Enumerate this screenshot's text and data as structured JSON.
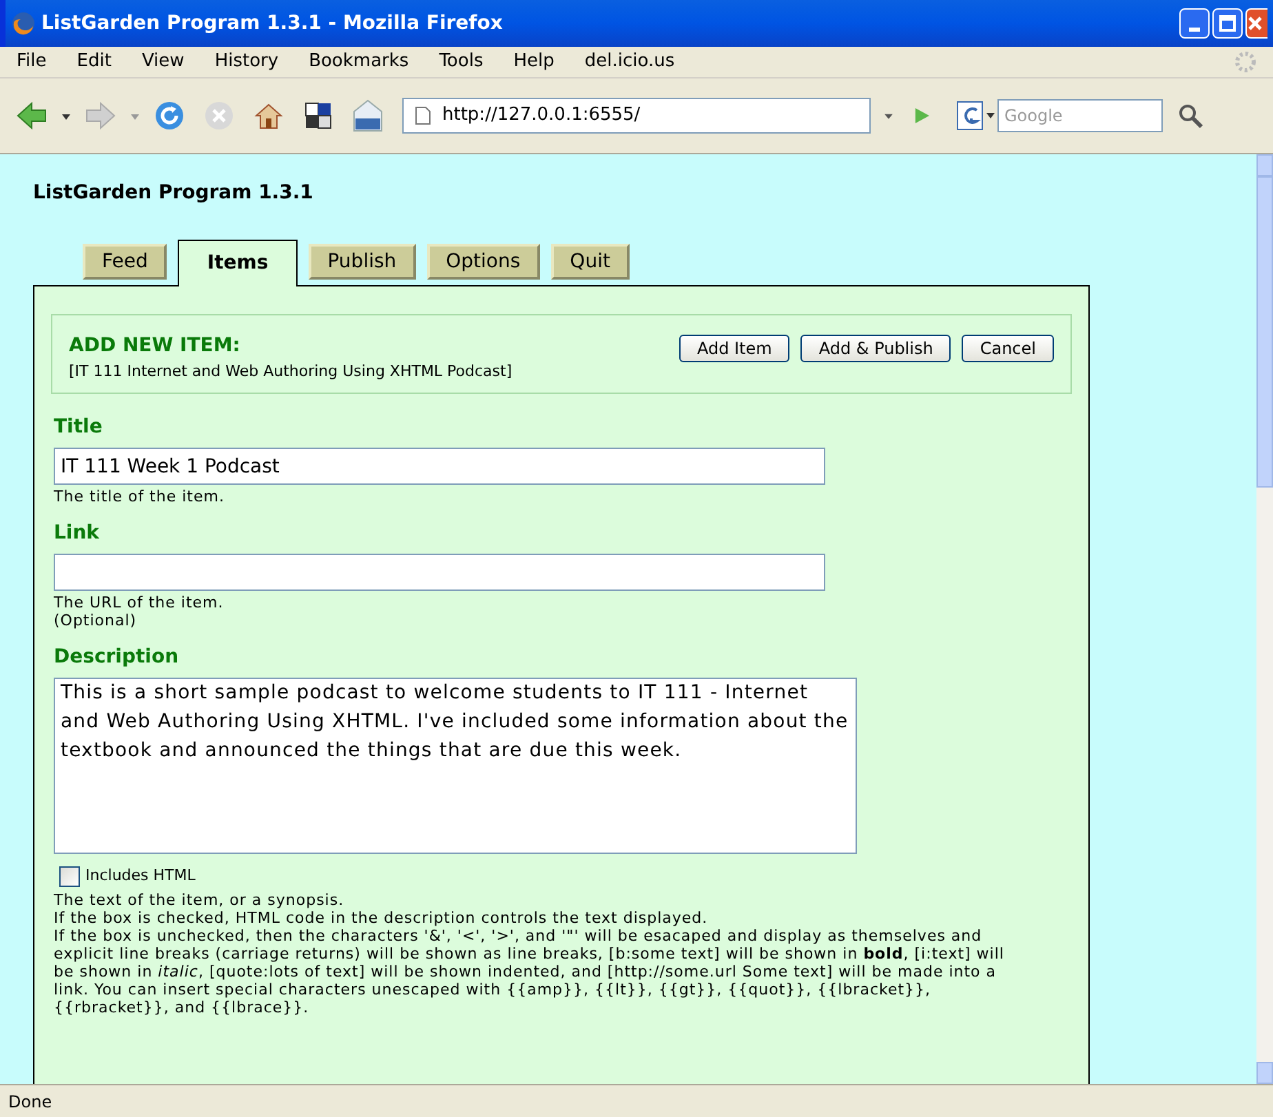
{
  "window": {
    "title": "ListGarden Program 1.3.1 - Mozilla Firefox"
  },
  "menu": [
    "File",
    "Edit",
    "View",
    "History",
    "Bookmarks",
    "Tools",
    "Help",
    "del.icio.us"
  ],
  "address_bar": {
    "value": "http://127.0.0.1:6555/"
  },
  "search": {
    "placeholder": "Google"
  },
  "page": {
    "heading": "ListGarden Program 1.3.1",
    "tabs": [
      {
        "label": "Feed",
        "selected": false
      },
      {
        "label": "Items",
        "selected": true
      },
      {
        "label": "Publish",
        "selected": false
      },
      {
        "label": "Options",
        "selected": false
      },
      {
        "label": "Quit",
        "selected": false
      }
    ],
    "add_item": {
      "heading": "ADD NEW ITEM:",
      "subtitle": "[IT 111 Internet and Web Authoring Using XHTML Podcast]",
      "buttons": [
        "Add Item",
        "Add & Publish",
        "Cancel"
      ]
    },
    "fields": [
      {
        "kind": "input",
        "label": "Title",
        "value": "IT 111 Week 1 Podcast",
        "help": [
          "The title of the item."
        ]
      },
      {
        "kind": "input",
        "label": "Link",
        "help": [
          "The URL of the item.",
          "(Optional)"
        ]
      },
      {
        "kind": "textarea",
        "label": "Description",
        "value": "This is a short sample podcast to welcome students to IT 111 - Internet and Web Authoring Using XHTML. I've included some information about the textbook and announced the things that are due this week.",
        "checkbox": {
          "label": "Includes HTML",
          "checked": false
        },
        "help": [
          "The text of the item, or a synopsis.",
          "If the box is checked, HTML code in the description controls the text displayed.",
          "If the box is unchecked, then the characters '&', '<', '>', and '\"' will be esacaped and display as themselves and explicit line breaks (carriage returns) will be shown as line breaks, [b:some text] will be shown in **bold**, [i:text] will be shown in *italic*, [quote:lots of text] will be shown indented, and [http://some.url Some text] will be made into a link. You can insert special characters unescaped with {{amp}}, {{lt}}, {{gt}}, {{quot}}, {{lbracket}}, {{rbracket}}, and {{lbrace}}."
        ]
      }
    ]
  },
  "status_bar": {
    "text": "Done"
  }
}
